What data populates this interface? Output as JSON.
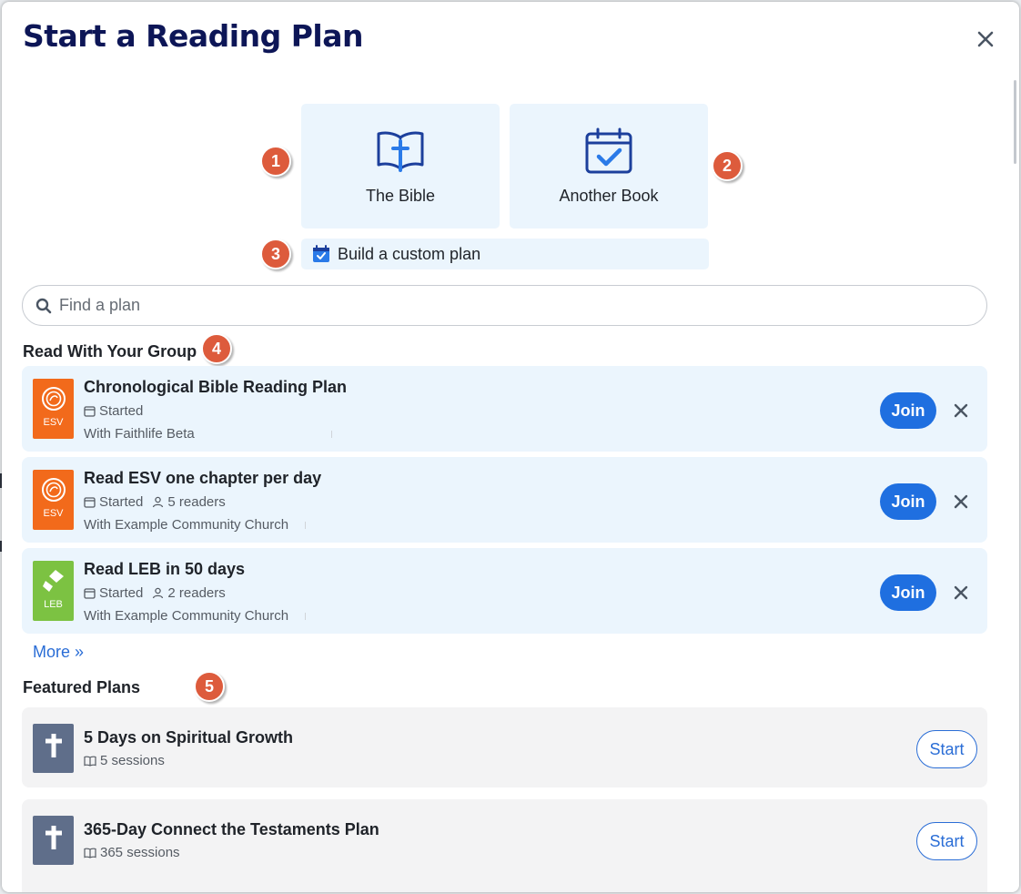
{
  "dialog": {
    "title": "Start a Reading Plan"
  },
  "sources": {
    "bible_label": "The Bible",
    "another_book_label": "Another Book",
    "custom_plan_label": "Build a custom plan"
  },
  "badges": [
    "1",
    "2",
    "3",
    "4",
    "5"
  ],
  "search": {
    "placeholder": "Find a plan"
  },
  "group_section": {
    "heading": "Read With Your Group",
    "join_label": "Join",
    "more_label": "More »",
    "plans": [
      {
        "thumb_label": "ESV",
        "title": "Chronological Bible Reading Plan",
        "status": "Started",
        "readers": "",
        "group": "With Faithlife Beta"
      },
      {
        "thumb_label": "ESV",
        "title": "Read ESV one chapter per day",
        "status": "Started",
        "readers": "5 readers",
        "group": "With Example Community Church"
      },
      {
        "thumb_label": "LEB",
        "title": "Read LEB in 50 days",
        "status": "Started",
        "readers": "2 readers",
        "group": "With Example Community Church"
      }
    ]
  },
  "featured_section": {
    "heading": "Featured Plans",
    "start_label": "Start",
    "plans": [
      {
        "title": "5 Days on Spiritual Growth",
        "sessions": "5 sessions"
      },
      {
        "title": "365-Day Connect the Testaments Plan",
        "sessions": "365 sessions"
      }
    ]
  },
  "colors": {
    "title": "#0d1657",
    "tile_bg": "#ebf5fd",
    "badge": "#dd5b3c",
    "join_button": "#1f6fe0",
    "link": "#2a6dd6",
    "esv_orange": "#f26a1b",
    "leb_green": "#7cc242",
    "featured_thumb": "#5f6e8a"
  }
}
